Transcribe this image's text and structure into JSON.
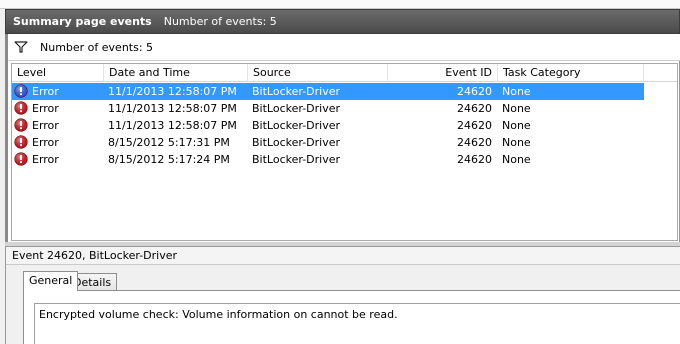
{
  "summary": {
    "title": "Summary page events",
    "count_label": "Number of events: 5"
  },
  "filter": {
    "count_label": "Number of events: 5"
  },
  "grid": {
    "columns": [
      "Level",
      "Date and Time",
      "Source",
      "Event ID",
      "Task Category"
    ],
    "rows": [
      {
        "level": "Error",
        "datetime": "11/1/2013 12:58:07 PM",
        "source": "BitLocker-Driver",
        "event_id": "24620",
        "task_category": "None",
        "selected": true,
        "icon": "info-icon"
      },
      {
        "level": "Error",
        "datetime": "11/1/2013 12:58:07 PM",
        "source": "BitLocker-Driver",
        "event_id": "24620",
        "task_category": "None",
        "selected": false,
        "icon": "error-icon"
      },
      {
        "level": "Error",
        "datetime": "11/1/2013 12:58:07 PM",
        "source": "BitLocker-Driver",
        "event_id": "24620",
        "task_category": "None",
        "selected": false,
        "icon": "error-icon"
      },
      {
        "level": "Error",
        "datetime": "8/15/2012 5:17:31 PM",
        "source": "BitLocker-Driver",
        "event_id": "24620",
        "task_category": "None",
        "selected": false,
        "icon": "error-icon"
      },
      {
        "level": "Error",
        "datetime": "8/15/2012 5:17:24 PM",
        "source": "BitLocker-Driver",
        "event_id": "24620",
        "task_category": "None",
        "selected": false,
        "icon": "error-icon"
      }
    ]
  },
  "detail": {
    "header": "Event 24620, BitLocker-Driver",
    "tabs": [
      "General",
      "Details"
    ],
    "active_tab": "General",
    "description": "Encrypted volume check: Volume information on  cannot be read."
  },
  "colors": {
    "selection": "#3399ff",
    "error_red": "#c0141c",
    "info_blue": "#3050c8",
    "header_dark": "#555555"
  }
}
